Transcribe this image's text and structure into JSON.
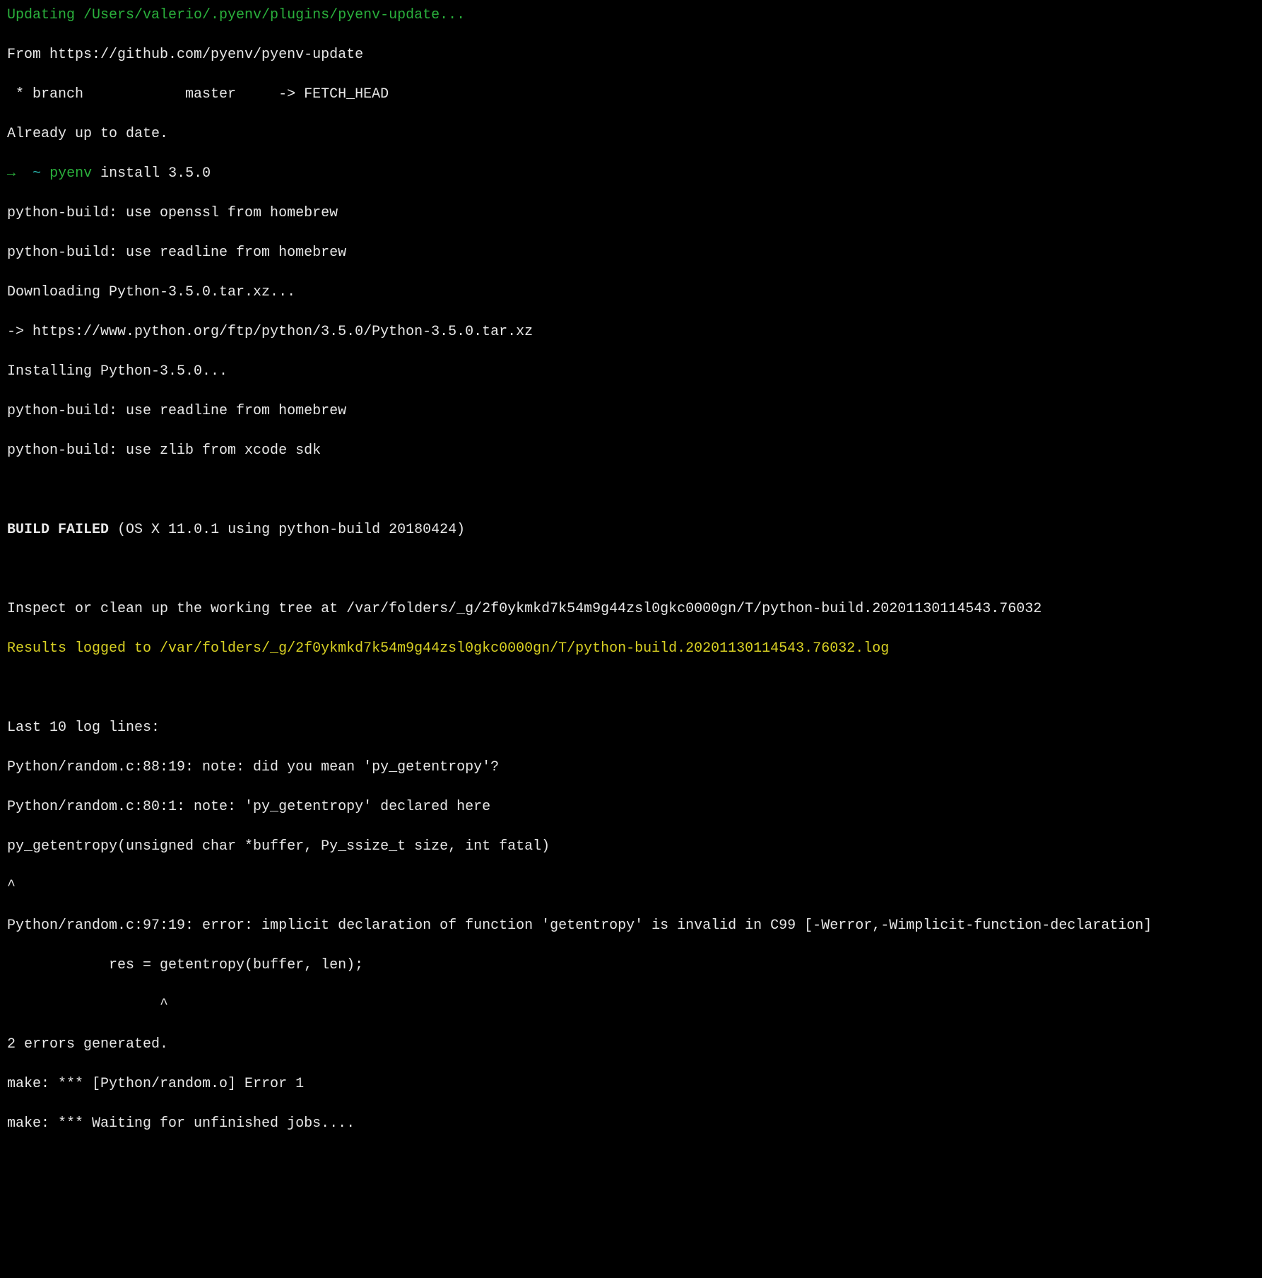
{
  "prompt": {
    "arrow": "→",
    "tilde": "~",
    "command": "pyenv",
    "args": "install 3.5.0"
  },
  "lines": {
    "updating": "Updating /Users/valerio/.pyenv/plugins/pyenv-update...",
    "from": "From https://github.com/pyenv/pyenv-update",
    "branch": " * branch            master     -> FETCH_HEAD",
    "uptodate": "Already up to date.",
    "openssl": "python-build: use openssl from homebrew",
    "readline1": "python-build: use readline from homebrew",
    "downloading": "Downloading Python-3.5.0.tar.xz...",
    "url": "-> https://www.python.org/ftp/python/3.5.0/Python-3.5.0.tar.xz",
    "installing": "Installing Python-3.5.0...",
    "readline2": "python-build: use readline from homebrew",
    "zlib": "python-build: use zlib from xcode sdk",
    "buildFailedBold": "BUILD FAILED",
    "buildFailedRest": "(OS X 11.0.1 using python-build 20180424)",
    "inspect": "Inspect or clean up the working tree at /var/folders/_g/2f0ykmkd7k54m9g44zsl0gkc0000gn/T/python-build.20201130114543.76032",
    "results": "Results logged to /var/folders/_g/2f0ykmkd7k54m9g44zsl0gkc0000gn/T/python-build.20201130114543.76032.log",
    "last10": "Last 10 log lines:",
    "note1": "Python/random.c:88:19: note: did you mean 'py_getentropy'?",
    "note2": "Python/random.c:80:1: note: 'py_getentropy' declared here",
    "decl": "py_getentropy(unsigned char *buffer, Py_ssize_t size, int fatal)",
    "caret1": "^",
    "error": "Python/random.c:97:19: error: implicit declaration of function 'getentropy' is invalid in C99 [-Werror,-Wimplicit-function-declaration]",
    "res": "            res = getentropy(buffer, len);",
    "caret2": "                  ^",
    "errors": "2 errors generated.",
    "make1": "make: *** [Python/random.o] Error 1",
    "make2": "make: *** Waiting for unfinished jobs...."
  }
}
